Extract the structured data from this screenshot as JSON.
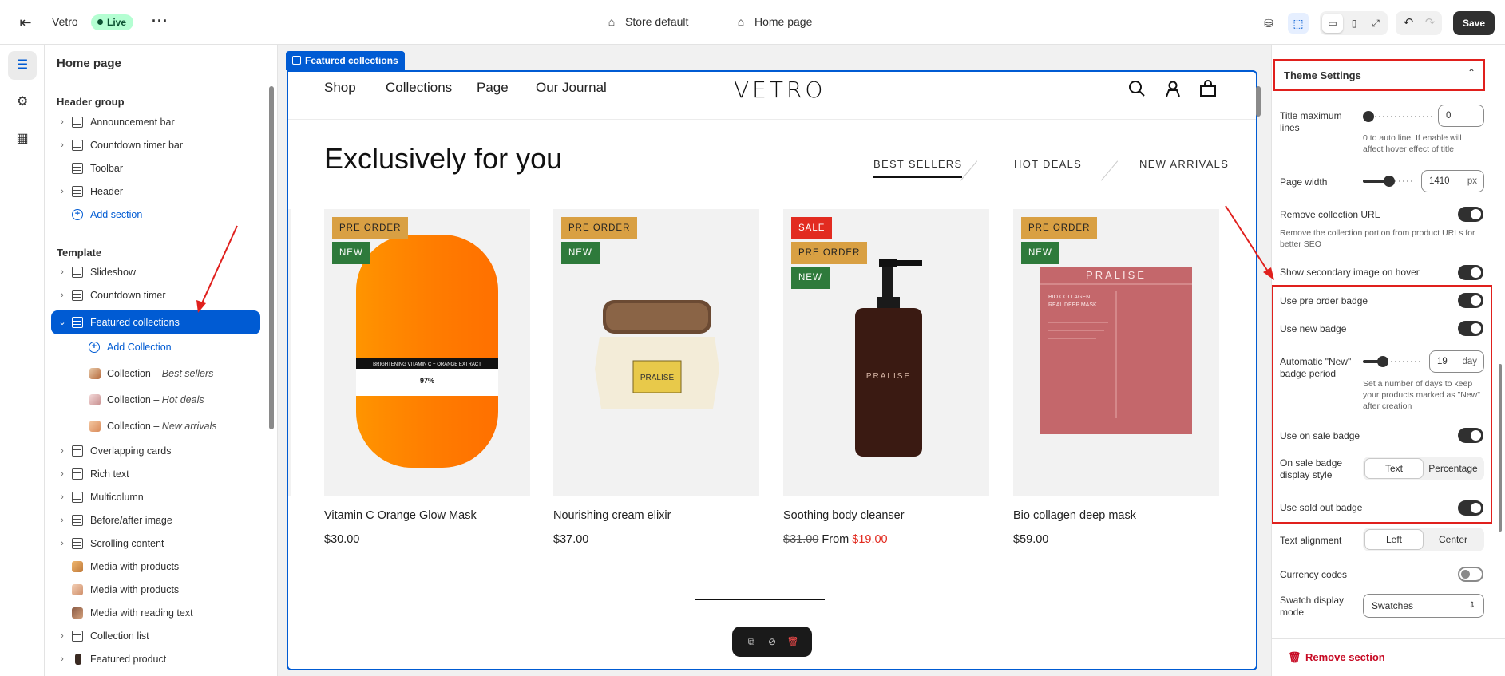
{
  "topbar": {
    "store_name": "Vetro",
    "status": "Live",
    "more": "···",
    "theme_context": "Store default",
    "page_context": "Home page",
    "save_label": "Save"
  },
  "sidebar": {
    "title": "Home page",
    "header_group_label": "Header group",
    "header_items": [
      "Announcement bar",
      "Countdown timer bar",
      "Toolbar",
      "Header"
    ],
    "add_section": "Add section",
    "template_label": "Template",
    "template_items": [
      "Slideshow",
      "Countdown timer",
      "Featured collections"
    ],
    "add_collection": "Add Collection",
    "collections": [
      {
        "prefix": "Collection – ",
        "name": "Best sellers"
      },
      {
        "prefix": "Collection – ",
        "name": "Hot deals"
      },
      {
        "prefix": "Collection – ",
        "name": "New arrivals"
      }
    ],
    "more_items": [
      "Overlapping cards",
      "Rich text",
      "Multicolumn",
      "Before/after image",
      "Scrolling content",
      "Media with products",
      "Media with products",
      "Media with reading text",
      "Collection list",
      "Featured product"
    ]
  },
  "preview": {
    "frame_label": "Featured collections",
    "nav_links": [
      "Shop",
      "Collections",
      "Page",
      "Our Journal"
    ],
    "logo": "VETRO",
    "section_title": "Exclusively for you",
    "tabs": [
      "BEST SELLERS",
      "HOT DEALS",
      "NEW ARRIVALS"
    ],
    "products": [
      {
        "name": "Vitamin C Orange Glow Mask",
        "price": "$30.00",
        "badges": [
          "PRE ORDER",
          "NEW"
        ],
        "pack_text": "BRIGHTENING VITAMIN C + ORANGE EXTRACT",
        "pack_pct": "97%"
      },
      {
        "name": "Nourishing cream elixir",
        "price": "$37.00",
        "badges": [
          "PRE ORDER",
          "NEW"
        ],
        "jar_label": "PRALISE"
      },
      {
        "name": "Soothing body cleanser",
        "old_price": "$31.00",
        "from_label": "From",
        "price": "$19.00",
        "badges": [
          "SALE",
          "PRE ORDER",
          "NEW"
        ],
        "bottle_label": "PRALISE"
      },
      {
        "name": "Bio collagen deep mask",
        "price": "$59.00",
        "badges": [
          "PRE ORDER",
          "NEW"
        ],
        "mask_brand": "PRALISE",
        "mask_line1": "BIO COLLAGEN",
        "mask_line2": "REAL DEEP MASK"
      }
    ]
  },
  "settings": {
    "section_title": "Theme Settings",
    "title_max_lines_label": "Title maximum lines",
    "title_max_lines_value": "0",
    "title_max_lines_help": "0 to auto line. If enable will affect hover effect of title",
    "page_width_label": "Page width",
    "page_width_value": "1410",
    "page_width_unit": "px",
    "remove_url_label": "Remove collection URL",
    "remove_url_help": "Remove the collection portion from product URLs for better SEO",
    "secondary_image_label": "Show secondary image on hover",
    "pre_order_label": "Use pre order badge",
    "new_badge_label": "Use new badge",
    "new_period_label": "Automatic \"New\" badge period",
    "new_period_value": "19",
    "new_period_unit": "day",
    "new_period_help": "Set a number of days to keep your products marked as \"New\" after creation",
    "on_sale_label": "Use on sale badge",
    "sale_style_label": "On sale badge display style",
    "sale_style_options": [
      "Text",
      "Percentage"
    ],
    "sold_out_label": "Use sold out badge",
    "text_align_label": "Text alignment",
    "text_align_options": [
      "Left",
      "Center"
    ],
    "currency_label": "Currency codes",
    "swatch_label": "Swatch display mode",
    "swatch_value": "Swatches",
    "remove_section": "Remove section",
    "toggles": {
      "remove_url": true,
      "secondary_image": true,
      "pre_order": true,
      "new_badge": true,
      "on_sale": true,
      "sold_out": true,
      "currency": false
    },
    "sliders": {
      "title_max_lines": 0.0,
      "page_width": 0.5,
      "new_period": 0.3
    }
  },
  "colors": {
    "accent": "#005bd3",
    "annotation": "#e0201d",
    "live_bg": "#b4fed2",
    "pre_order": "#d9a043",
    "new": "#2e7a3b",
    "sale": "#e22b20"
  }
}
